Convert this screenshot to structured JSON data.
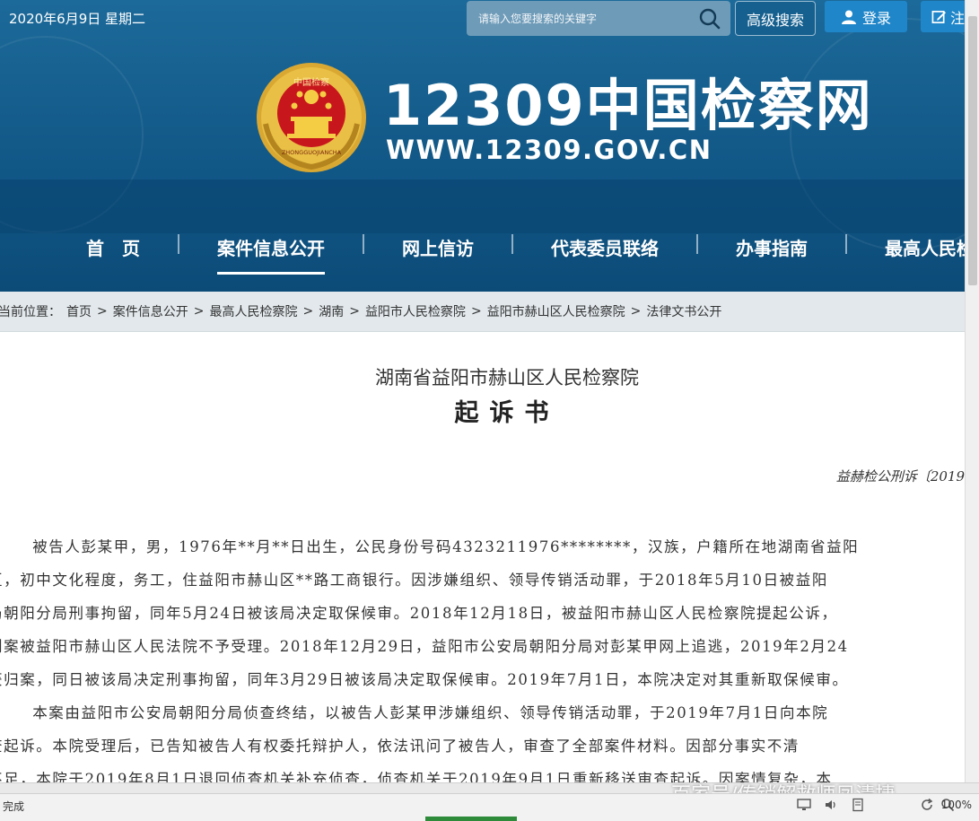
{
  "topbar": {
    "date": "2020年6月9日 星期二",
    "search_placeholder": "请输入您要搜索的关键字",
    "advanced_search": "高级搜索",
    "login": "登录",
    "register": "注"
  },
  "site": {
    "title": "12309中国检察网",
    "url": "WWW.12309.GOV.CN",
    "emblem_top_text": "中国检察",
    "emblem_bottom_text": "ZHONGGUOJIANCHA"
  },
  "nav": {
    "items": [
      {
        "label": "首　页"
      },
      {
        "label": "案件信息公开"
      },
      {
        "label": "网上信访"
      },
      {
        "label": "代表委员联络"
      },
      {
        "label": "办事指南"
      },
      {
        "label": "最高人民检"
      }
    ],
    "active_index": 1
  },
  "breadcrumb": {
    "prefix": "当前位置：",
    "items": [
      "首页",
      "案件信息公开",
      "最高人民检察院",
      "湖南",
      "益阳市人民检察院",
      "益阳市赫山区人民检察院",
      "法律文书公开"
    ],
    "separator": ">"
  },
  "document": {
    "org": "湖南省益阳市赫山区人民检察院",
    "title": "起诉书",
    "number": "益赫检公刑诉〔2019",
    "lines": [
      "　　被告人彭某甲，男，1976年**月**日出生，公民身份号码4323211976********，汉族，户籍所在地湖南省益阳",
      "区，初中文化程度，务工，住益阳市赫山区**路工商银行。因涉嫌组织、领导传销活动罪，于2018年5月10日被益阳",
      "局朝阳分局刑事拘留，同年5月24日被该局决定取保候审。2018年12月18日，被益阳市赫山区人民检察院提起公诉，",
      "刑案被益阳市赫山区人民法院不予受理。2018年12月29日，益阳市公安局朝阳分局对彭某甲网上追逃，2019年2月24",
      "获归案，同日被该局决定刑事拘留，同年3月29日被该局决定取保候审。2019年7月1日，本院决定对其重新取保候审。",
      "　　本案由益阳市公安局朝阳分局侦查终结，以被告人彭某甲涉嫌组织、领导传销活动罪，于2019年7月1日向本院",
      "查起诉。本院受理后，已告知被告人有权委托辩护人，依法讯问了被告人，审查了全部案件材料。因部分事实不清",
      "不足，本院于2019年8月1日退回侦查机关补充侦查，侦查机关于2019年9月1日重新移送审查起诉。因案情复杂，本"
    ]
  },
  "watermark": "百家号/传销解救师凤清捷",
  "statusbar": {
    "text": "完成",
    "zoom": "100%"
  },
  "colors": {
    "header_blue": "#155d8c",
    "nav_blue": "#0f5483",
    "button_blue": "#1f86c9",
    "emblem_red": "#c8161d",
    "emblem_gold": "#e3b338"
  }
}
